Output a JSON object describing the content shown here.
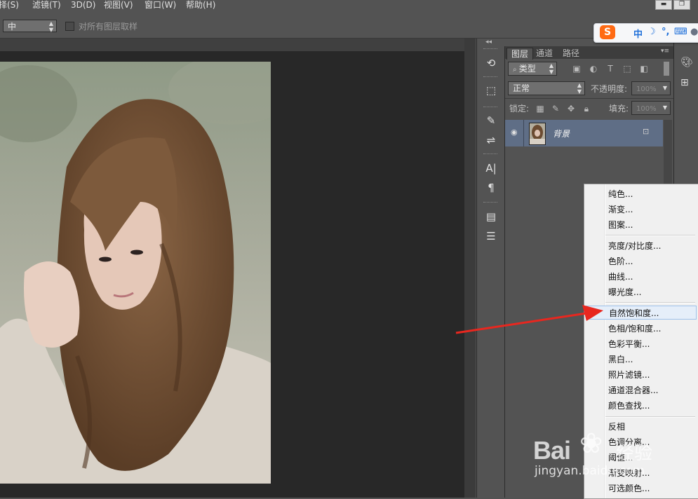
{
  "menubar": {
    "items": [
      {
        "label": "选择(S)",
        "shown": "择(S)"
      },
      {
        "label": "滤镜(T)"
      },
      {
        "label": "3D(D)"
      },
      {
        "label": "视图(V)"
      },
      {
        "label": "窗口(W)"
      },
      {
        "label": "帮助(H)"
      }
    ],
    "window_buttons": [
      "minimize",
      "restore"
    ]
  },
  "options": {
    "sample_size_value": "中",
    "all_layers_label": "对所有图层取样",
    "all_layers_checked": false
  },
  "ime": {
    "logo": "S",
    "mode": "中",
    "icons": [
      "moon-icon",
      "punctuation-icon",
      "keyboard-icon",
      "user-icon"
    ]
  },
  "layers_panel": {
    "tabs": [
      "图层",
      "通道",
      "路径"
    ],
    "active_tab": "图层",
    "filter_kind": "类型",
    "blend_mode": "正常",
    "opacity_label": "不透明度:",
    "opacity_value": "100%",
    "lock_label": "锁定:",
    "fill_label": "填充:",
    "fill_value": "100%",
    "layers": [
      {
        "name": "背景",
        "visible": true,
        "locked": true
      }
    ]
  },
  "dock": {
    "icons": [
      "history-icon",
      "3d-icon",
      "brush-presets-icon",
      "adjust-icon",
      "character-icon",
      "paragraph-icon",
      "notes-icon",
      "properties-icon"
    ]
  },
  "context_menu": {
    "groups": [
      [
        "纯色...",
        "渐变...",
        "图案..."
      ],
      [
        "亮度/对比度...",
        "色阶...",
        "曲线...",
        "曝光度..."
      ],
      [
        "自然饱和度...",
        "色相/饱和度...",
        "色彩平衡...",
        "黑白...",
        "照片滤镜...",
        "通道混合器...",
        "颜色查找..."
      ],
      [
        "反相",
        "色调分离...",
        "阈值...",
        "渐变映射...",
        "可选颜色..."
      ]
    ],
    "highlighted": "自然饱和度..."
  },
  "annotation": {
    "color": "#e8271f"
  },
  "watermark": {
    "brand": "Bai",
    "suffix": "经验",
    "url": "jingyan.baidu.com"
  },
  "colors": {
    "ui_bg": "#535353",
    "canvas_bg": "#282828",
    "selected_layer": "#5f6e86",
    "menu_highlight": "#e5eef9",
    "ime_logo": "#ff6a13"
  }
}
